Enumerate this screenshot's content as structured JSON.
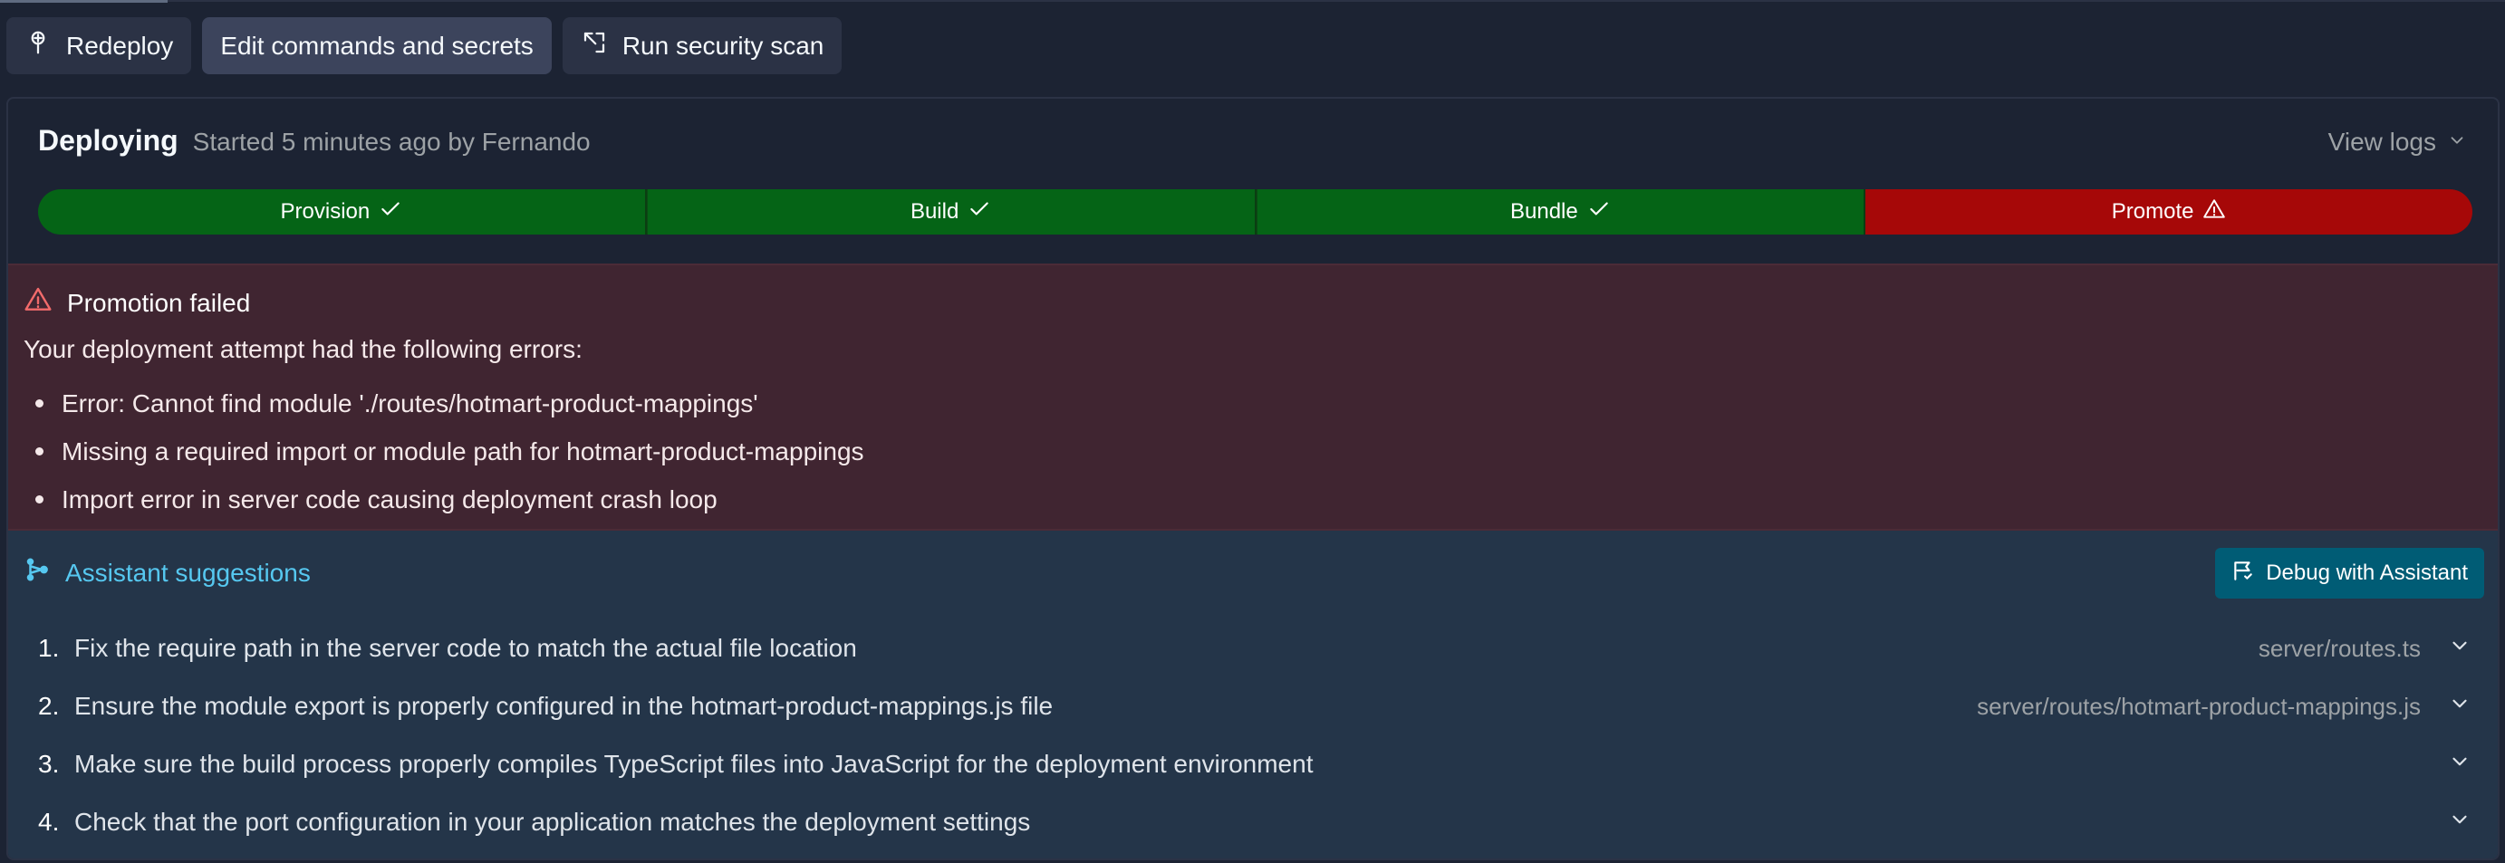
{
  "toolbar": {
    "redeploy_label": "Redeploy",
    "edit_label": "Edit commands and secrets",
    "scan_label": "Run security scan"
  },
  "deployment": {
    "status": "Deploying",
    "subtitle": "Started 5 minutes ago by Fernando",
    "view_logs_label": "View logs",
    "steps": [
      {
        "label": "Provision",
        "state": "done"
      },
      {
        "label": "Build",
        "state": "done"
      },
      {
        "label": "Bundle",
        "state": "done"
      },
      {
        "label": "Promote",
        "state": "failed"
      }
    ]
  },
  "error": {
    "title": "Promotion failed",
    "intro": "Your deployment attempt had the following errors:",
    "items": [
      "Error: Cannot find module './routes/hotmart-product-mappings'",
      "Missing a required import or module path for hotmart-product-mappings",
      "Import error in server code causing deployment crash loop"
    ]
  },
  "assistant": {
    "title": "Assistant suggestions",
    "debug_label": "Debug with Assistant",
    "suggestions": [
      {
        "num": "1.",
        "text": "Fix the require path in the server code to match the actual file location",
        "file": "server/routes.ts"
      },
      {
        "num": "2.",
        "text": "Ensure the module export is properly configured in the hotmart-product-mappings.js file",
        "file": "server/routes/hotmart-product-mappings.js"
      },
      {
        "num": "3.",
        "text": "Make sure the build process properly compiles TypeScript files into JavaScript for the deployment environment",
        "file": ""
      },
      {
        "num": "4.",
        "text": "Check that the port configuration in your application matches the deployment settings",
        "file": ""
      }
    ]
  },
  "colors": {
    "success": "#056416",
    "failure": "#a60808",
    "error_bg": "#402531",
    "assistant_bg": "#243549",
    "accent": "#56c8f0",
    "debug_button": "#005c75"
  }
}
